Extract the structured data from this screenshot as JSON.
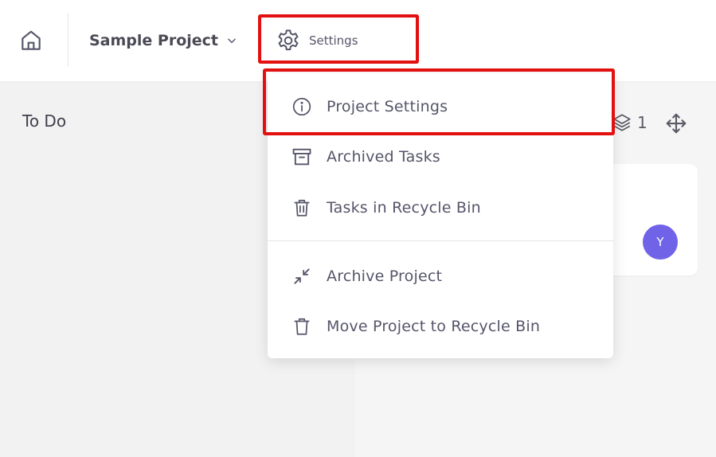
{
  "header": {
    "project_name": "Sample Project",
    "settings_label": "Settings"
  },
  "board": {
    "column_title": "To Do",
    "layers_count": "1",
    "card_avatar_initial": "Y"
  },
  "dropdown": {
    "items": [
      {
        "label": "Project Settings",
        "icon": "info-icon"
      },
      {
        "label": "Archived Tasks",
        "icon": "archive-box-icon"
      },
      {
        "label": "Tasks in Recycle Bin",
        "icon": "trash-icon"
      },
      {
        "label": "Archive Project",
        "icon": "collapse-arrows-icon"
      },
      {
        "label": "Move Project to Recycle Bin",
        "icon": "trash-icon"
      }
    ]
  },
  "colors": {
    "highlight": "#e21010",
    "avatar": "#7063e8",
    "text": "#55556a"
  }
}
